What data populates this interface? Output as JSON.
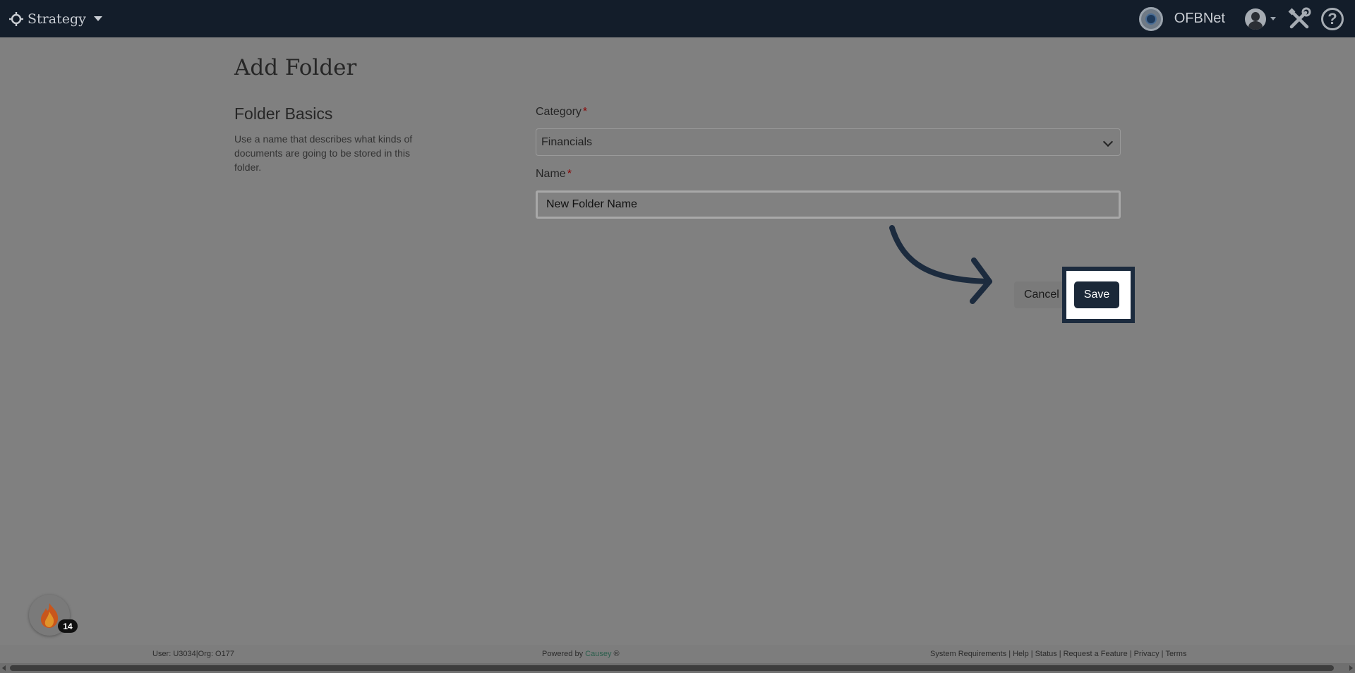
{
  "header": {
    "app_name": "Strategy",
    "org_name": "OFBNet",
    "icons": [
      "target-icon",
      "caret-down-icon",
      "org-icon",
      "avatar",
      "tools-icon",
      "help-icon"
    ],
    "help_glyph": "?"
  },
  "page": {
    "title": "Add Folder",
    "section_title": "Folder Basics",
    "section_description": "Use a name that describes what kinds of documents are going to be stored in this folder."
  },
  "form": {
    "category_label": "Category",
    "category_value": "Financials",
    "name_label": "Name",
    "name_value": "New Folder Name",
    "required_marker": "*",
    "cancel_label": "Cancel",
    "save_label": "Save"
  },
  "badge": {
    "icon": "fire-icon",
    "count": "14"
  },
  "footer": {
    "user_org": "User: U3034|Org: O177",
    "powered_prefix": "Powered by ",
    "powered_brand": "Causey",
    "powered_suffix": " ®",
    "links": [
      "System Requirements",
      "Help",
      "Status",
      "Request a Feature",
      "Privacy",
      "Terms"
    ],
    "separator": "|"
  },
  "colors": {
    "header_bg": "#131d2a",
    "overlay_bg": "#808080",
    "save_bg": "#1b2838",
    "highlight_border": "#1c2b3e",
    "required": "#8b0000",
    "causey_link": "#2c5f4d"
  }
}
